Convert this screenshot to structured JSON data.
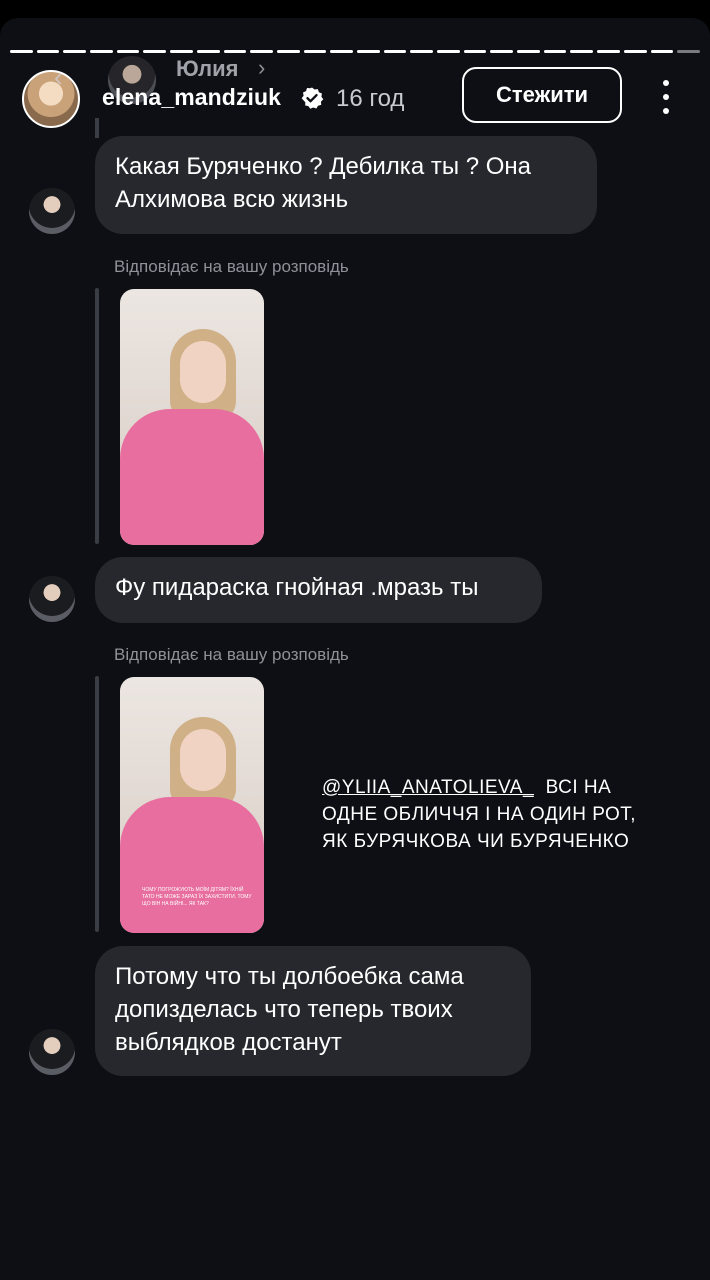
{
  "progress": {
    "segments": 26,
    "done": 25
  },
  "header": {
    "dm_contact_name": "Юлия",
    "username": "elena_mandziuk",
    "time_ago": "16 год",
    "follow_label": "Стежити"
  },
  "messages": [
    {
      "text": "Какая Буряченко ? Дебилка ты ? Она Алхимова всю жизнь"
    },
    {
      "reply_label": "Відповідає на вашу розповідь",
      "text": "Фу пидараска гнойная .мразь ты"
    },
    {
      "reply_label": "Відповідає на вашу розповідь",
      "text": "Потому что ты долбоебка сама допизделась что теперь твоих выблядков достанут"
    }
  ],
  "story_overlay": {
    "mention": "@YLIIA_ANATOLIEVA_",
    "text": "ВСІ НА ОДНЕ ОБЛИЧЧЯ І НА ОДИН РОТ, ЯК БУРЯЧКОВА ЧИ БУРЯЧЕНКО"
  },
  "thumb2_caption": "Чому погрожують моїм дітям? Їхній тато не може зараз їх захистити. Тому що він на війні... Як так?",
  "colors": {
    "background": "#0d0f14",
    "bubble": "#26282d",
    "muted_text": "#8e9198"
  }
}
